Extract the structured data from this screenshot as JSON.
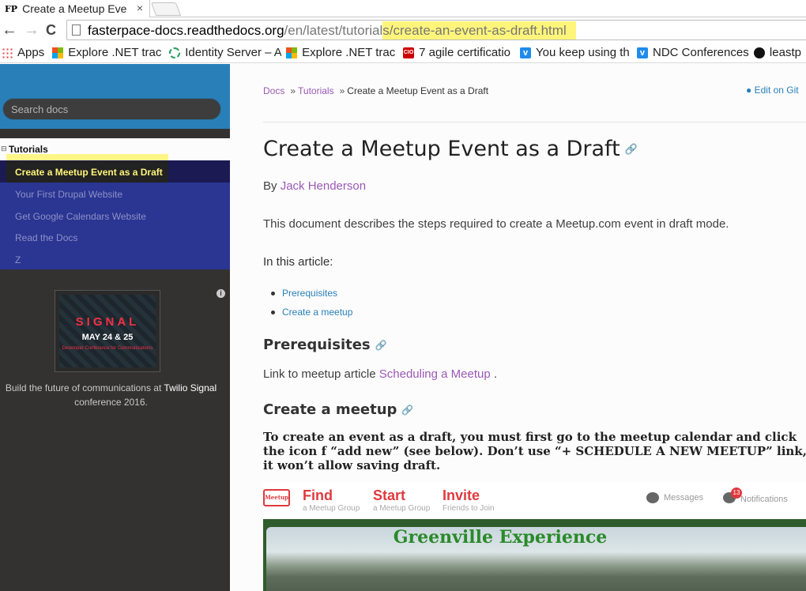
{
  "browser": {
    "tab": {
      "favicon": "FP",
      "title": "Create a Meetup Eve",
      "close_glyph": "×"
    },
    "nav": {
      "back": "←",
      "forward": "→",
      "reload": "C"
    },
    "url": {
      "host": "fasterpace-docs.readthedocs.org",
      "path_plain": "/en/latest/tutorial",
      "path_highlight": "s/create-an-event-as-draft.html"
    },
    "bookmarks": [
      {
        "icon": "apps-icon",
        "label": "Apps"
      },
      {
        "icon": "microsoft-icon",
        "label": "Explore .NET trac"
      },
      {
        "icon": "identity-server-icon",
        "label": "Identity Server – A"
      },
      {
        "icon": "microsoft-icon",
        "label": "Explore .NET trac"
      },
      {
        "icon": "cio-icon",
        "label": "7 agile certificatio"
      },
      {
        "icon": "vimeo-icon",
        "label": "You keep using th"
      },
      {
        "icon": "vimeo-icon",
        "label": "NDC Conferences"
      },
      {
        "icon": "github-icon",
        "label": "leastp"
      }
    ]
  },
  "sidebar": {
    "search_placeholder": "Search docs",
    "section_glyph": "⊟",
    "section": "Tutorials",
    "current": "Create a Meetup Event as a Draft",
    "links": [
      "Your First Drupal Website",
      "Get Google Calendars Website",
      "Read the Docs",
      "Z"
    ],
    "ad": {
      "title": "SIGNAL",
      "date": "MAY 24 & 25",
      "sub": "Developer Conference for Communications",
      "text_before": "Build the future of communications at ",
      "brand": "Twilio Signal",
      "text_after": " conference 2016."
    }
  },
  "content": {
    "breadcrumbs": {
      "docs": "Docs",
      "sep": "»",
      "tutorials": "Tutorials",
      "current": "Create a Meetup Event as a Draft"
    },
    "edit_link": "Edit on Git",
    "title": "Create a Meetup Event as a Draft",
    "byline_prefix": "By ",
    "author": "Jack Henderson",
    "intro": "This document describes the steps required to create a Meetup.com event in draft mode.",
    "toc_heading": "In this article:",
    "toc": [
      "Prerequisites",
      "Create a meetup"
    ],
    "prereq_heading": "Prerequisites",
    "prereq_text_before": "Link to meetup article ",
    "prereq_link": "Scheduling a Meetup",
    "prereq_text_after": " .",
    "create_heading": "Create a meetup",
    "instructions": "To create an event as a draft, you must first go to the meetup calendar and click the icon f “add new” (see below). Don’t use “+ SCHEDULE A NEW MEETUP” link, it won’t allow saving draft.",
    "meetup_ui": {
      "logo": "Meetup",
      "nav": [
        {
          "big": "Find",
          "small": "a Meetup Group"
        },
        {
          "big": "Start",
          "small": "a Meetup Group"
        },
        {
          "big": "Invite",
          "small": "Friends to Join"
        }
      ],
      "messages": "Messages",
      "notifications": "Notifications",
      "notification_count": "13",
      "banner_title": "Greenville Experience"
    }
  },
  "colors": {
    "sidebar_top": "#2980b9",
    "sidebar_bg": "#343131",
    "link": "#9b59b6",
    "accent": "#2980b9",
    "highlight": "#fff57a"
  }
}
